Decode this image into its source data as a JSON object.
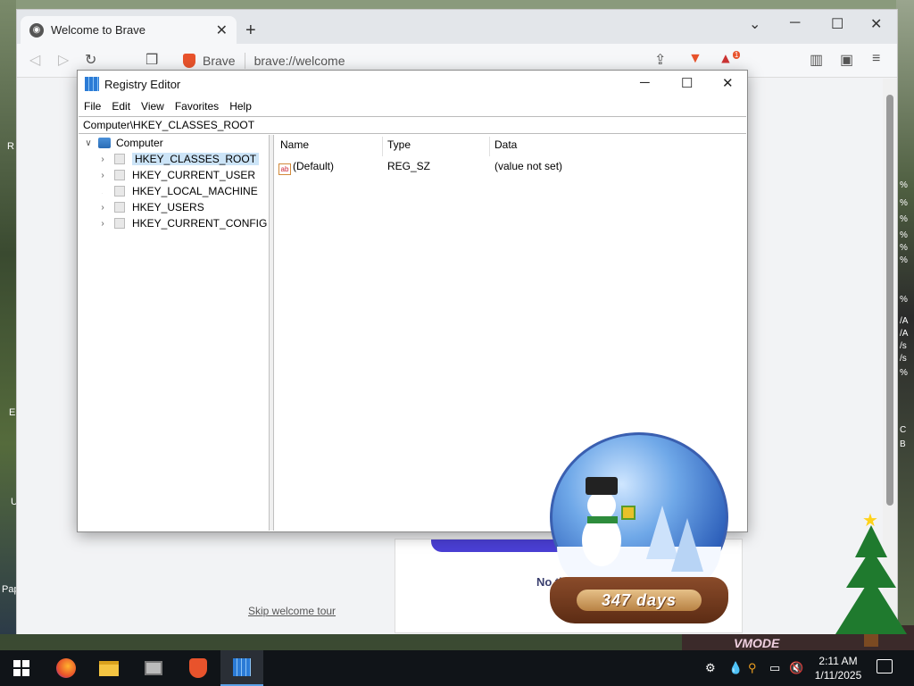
{
  "browser": {
    "tab_title": "Welcome to Brave",
    "brand_label": "Brave",
    "url": "brave://welcome",
    "rewards_badge": "1",
    "skip_link": "Skip welcome tour",
    "card_text": "No th"
  },
  "regedit": {
    "title": "Registry Editor",
    "menu": [
      "File",
      "Edit",
      "View",
      "Favorites",
      "Help"
    ],
    "path": "Computer\\HKEY_CLASSES_ROOT",
    "tree": {
      "root": "Computer",
      "items": [
        "HKEY_CLASSES_ROOT",
        "HKEY_CURRENT_USER",
        "HKEY_LOCAL_MACHINE",
        "HKEY_USERS",
        "HKEY_CURRENT_CONFIG"
      ],
      "selected_index": 0
    },
    "columns": [
      "Name",
      "Type",
      "Data"
    ],
    "rows": [
      {
        "name": "(Default)",
        "type": "REG_SZ",
        "data": "(value not set)",
        "icon_text": "ab"
      }
    ]
  },
  "widget": {
    "days": "347 days"
  },
  "taskbar": {
    "time": "2:11 AM",
    "date": "1/11/2025",
    "apps": [
      "start-button",
      "firefox",
      "file-explorer",
      "usb-tool",
      "brave",
      "registry-editor"
    ],
    "active_app": "registry-editor"
  },
  "desktop": {
    "labels": [
      "R",
      "E",
      "U",
      "Pap"
    ],
    "right_labels": [
      "%",
      "%",
      "%",
      "%",
      "%",
      "%",
      "%",
      "/A",
      "/A",
      "/s",
      "/s",
      "%",
      "C",
      "B"
    ],
    "logo_text": "VMODE"
  },
  "colors": {
    "brave_orange": "#e8532c",
    "selection": "#cce4f7",
    "taskbar": "#101418"
  }
}
